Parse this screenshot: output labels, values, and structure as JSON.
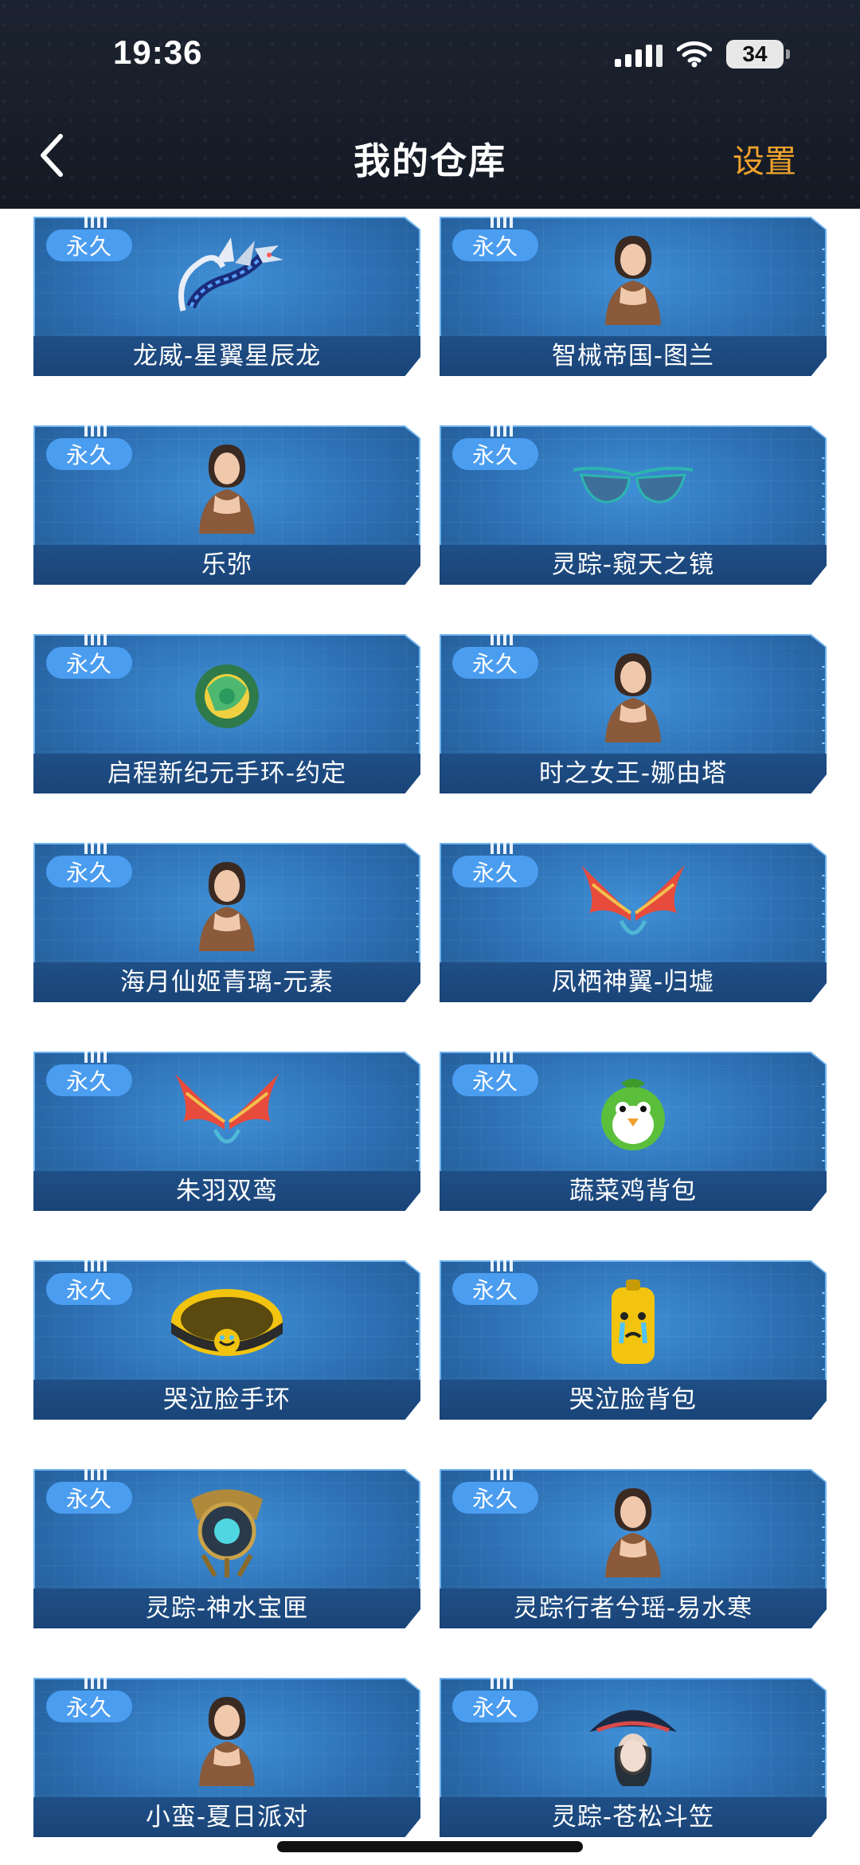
{
  "status_bar": {
    "time": "19:36",
    "battery": "34"
  },
  "header": {
    "title": "我的仓库",
    "settings_label": "设置"
  },
  "colors": {
    "accent": "#f1a22c",
    "card_blue": "#2c6fb2",
    "badge_blue": "#4b9df0"
  },
  "items": [
    {
      "badge": "永久",
      "name": "龙威-星翼星辰龙",
      "icon": "dragon-icon"
    },
    {
      "badge": "永久",
      "name": "智械帝国-图兰",
      "icon": "character-icon"
    },
    {
      "badge": "永久",
      "name": "乐弥",
      "icon": "character-icon"
    },
    {
      "badge": "永久",
      "name": "灵踪-窥天之镜",
      "icon": "glasses-icon"
    },
    {
      "badge": "永久",
      "name": "启程新纪元手环-约定",
      "icon": "bracelet-icon"
    },
    {
      "badge": "永久",
      "name": "时之女王-娜由塔",
      "icon": "character-icon"
    },
    {
      "badge": "永久",
      "name": "海月仙姬青璃-元素",
      "icon": "character-icon"
    },
    {
      "badge": "永久",
      "name": "凤栖神翼-归墟",
      "icon": "wings-icon"
    },
    {
      "badge": "永久",
      "name": "朱羽双鸾",
      "icon": "wings-icon"
    },
    {
      "badge": "永久",
      "name": "蔬菜鸡背包",
      "icon": "chicken-backpack-icon"
    },
    {
      "badge": "永久",
      "name": "哭泣脸手环",
      "icon": "crying-bracelet-icon"
    },
    {
      "badge": "永久",
      "name": "哭泣脸背包",
      "icon": "crying-backpack-icon"
    },
    {
      "badge": "永久",
      "name": "灵踪-神水宝匣",
      "icon": "treasure-box-icon"
    },
    {
      "badge": "永久",
      "name": "灵踪行者兮瑶-易水寒",
      "icon": "character-icon"
    },
    {
      "badge": "永久",
      "name": "小蛮-夏日派对",
      "icon": "character-icon"
    },
    {
      "badge": "永久",
      "name": "灵踪-苍松斗笠",
      "icon": "hat-icon"
    }
  ]
}
